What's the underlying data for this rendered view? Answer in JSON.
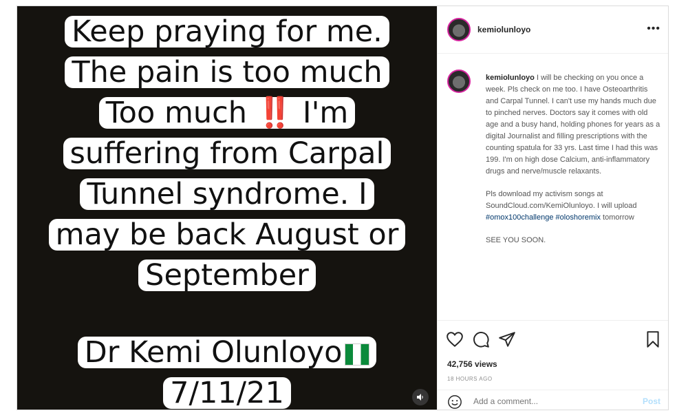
{
  "media": {
    "lines": [
      "Keep praying for me.",
      "The pain is too much",
      "Too much",
      "‼️",
      "I'm",
      "suffering from Carpal",
      "Tunnel syndrome. I",
      "may be back August or",
      "September"
    ],
    "signature": "Dr Kemi Olunloyo",
    "date": "7/11/21"
  },
  "header": {
    "username": "kemiolunloyo",
    "more": "•••"
  },
  "caption": {
    "username": "kemiolunloyo",
    "text1": "I will be checking on you once a week. Pls check on me too. I have Osteoarthritis and Carpal Tunnel. I can't use my hands much due to pinched nerves. Doctors say it comes with old age and a busy hand, holding phones for years as a digital Journalist and filling prescriptions with the counting spatula for 33 yrs. Last time I had this was 199. I'm on high dose Calcium, anti-inflammatory drugs and nerve/muscle relaxants.",
    "text2_part1": "Pls download my activism songs at SoundCloud.com/KemiOlunloyo. I will upload",
    "hashtag1": "#omox100challenge",
    "hashtag2": "#oloshoremix",
    "text2_part2": "tomorrow",
    "text3": "SEE YOU SOON."
  },
  "stats": {
    "views": "42,756 views",
    "time": "18 HOURS AGO"
  },
  "comment_box": {
    "placeholder": "Add a comment...",
    "post_label": "Post"
  },
  "colors": {
    "media_bg": "#15130f",
    "hashtag": "#00376b",
    "post_button": "#b2dffc"
  }
}
